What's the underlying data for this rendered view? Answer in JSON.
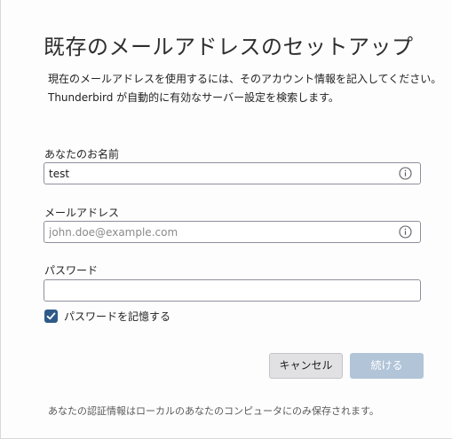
{
  "header": {
    "title": "既存のメールアドレスのセットアップ",
    "description_line1": "現在のメールアドレスを使用するには、そのアカウント情報を記入してください。",
    "description_line2": "Thunderbird が自動的に有効なサーバー設定を検索します。"
  },
  "form": {
    "name": {
      "label": "あなたのお名前",
      "value": "test",
      "placeholder": ""
    },
    "email": {
      "label": "メールアドレス",
      "value": "",
      "placeholder": "john.doe@example.com"
    },
    "password": {
      "label": "パスワード",
      "value": "",
      "placeholder": ""
    },
    "remember_password": {
      "label": "パスワードを記憶する",
      "checked": true
    }
  },
  "buttons": {
    "cancel_label": "キャンセル",
    "continue_label": "続ける"
  },
  "footer": {
    "note": "あなたの認証情報はローカルのあなたのコンピュータにのみ保存されます。"
  },
  "colors": {
    "accent": "#2f5a88",
    "continue_disabled": "#b1c4d8",
    "cancel_bg": "#e1e1e4"
  },
  "icons": {
    "info": "info-icon",
    "check": "checkmark-icon"
  }
}
